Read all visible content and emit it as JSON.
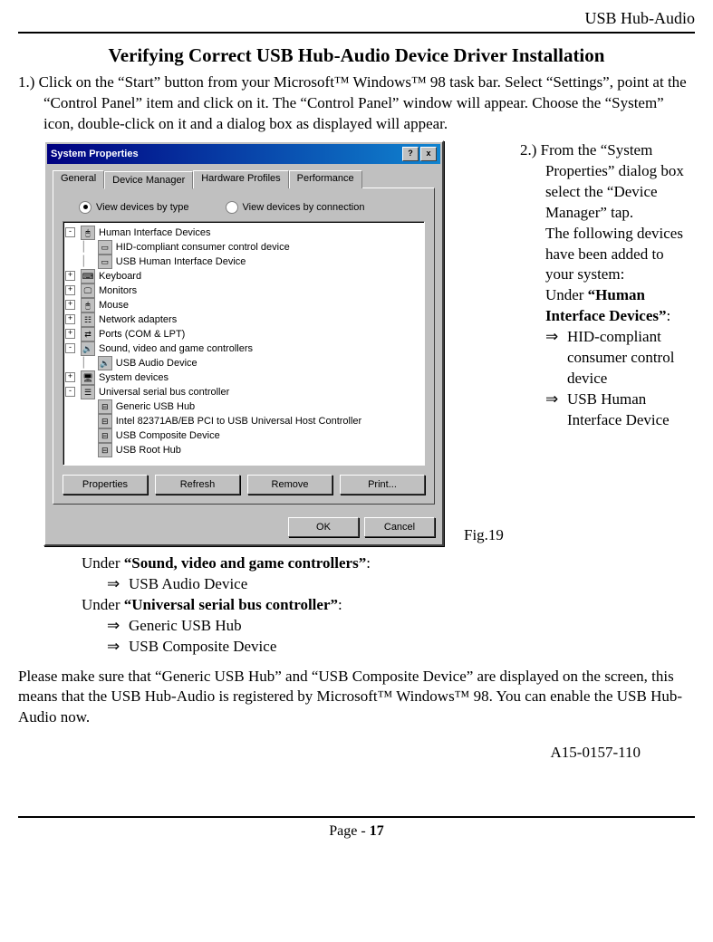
{
  "header": {
    "product": "USB Hub-Audio"
  },
  "title": "Verifying Correct USB Hub-Audio Device Driver Installation",
  "step1": {
    "num": "1.)",
    "text": "Click on the “Start” button from your Microsoft™ Windows™ 98 task bar. Select “Settings”, point at the “Control Panel” item and click on it. The “Control Panel” window will appear. Choose the “System” icon, double-click on it and a dialog box as displayed will appear."
  },
  "dialog": {
    "title": "System Properties",
    "tabs": {
      "general": "General",
      "device": "Device Manager",
      "hw": "Hardware Profiles",
      "perf": "Performance"
    },
    "radios": {
      "bytype": "View devices by type",
      "byconn": "View devices by connection"
    },
    "tree": {
      "hid": "Human Interface Devices",
      "hid1": "HID-compliant consumer control device",
      "hid2": "USB Human Interface Device",
      "kb": "Keyboard",
      "mon": "Monitors",
      "mouse": "Mouse",
      "net": "Network adapters",
      "ports": "Ports (COM & LPT)",
      "svg": "Sound, video and game controllers",
      "svg1": "USB Audio Device",
      "sys": "System devices",
      "usb": "Universal serial bus controller",
      "usb1": "Generic USB Hub",
      "usb2": "Intel 82371AB/EB PCI to USB Universal Host Controller",
      "usb3": "USB Composite Device",
      "usb4": "USB Root Hub"
    },
    "buttons": {
      "properties": "Properties",
      "refresh": "Refresh",
      "remove": "Remove",
      "print": "Print..."
    },
    "bottom": {
      "ok": "OK",
      "cancel": "Cancel"
    }
  },
  "figcap": "Fig.19",
  "step2": {
    "num": "2.)",
    "l1": "From the “System Properties” dialog box select the “Device Manager” tap.",
    "l2": "The following devices have been added to your system:",
    "under_hid_pre": "Under ",
    "under_hid_bold": "“Human Interface Devices”",
    "colon": ":",
    "it1": "HID-compliant consumer control device",
    "it2": "USB Human Interface Device"
  },
  "after": {
    "under_svg_pre": "Under ",
    "under_svg_bold": "“Sound, video and game controllers”",
    "svg_it1": "USB Audio Device",
    "under_usb_pre": "Under ",
    "under_usb_bold": "“Universal serial bus controller”",
    "usb_it1": "Generic USB Hub",
    "usb_it2": "USB Composite Device"
  },
  "footer_para": "Please make sure that “Generic USB Hub” and “USB Composite Device” are displayed on the screen, this means that the USB Hub-Audio is registered by Microsoft™ Windows™ 98. You can enable the USB Hub-Audio now.",
  "docnum": "A15-0157-110",
  "page_label_pre": "Page - ",
  "page_label_num": "17",
  "arrow": "⇒"
}
